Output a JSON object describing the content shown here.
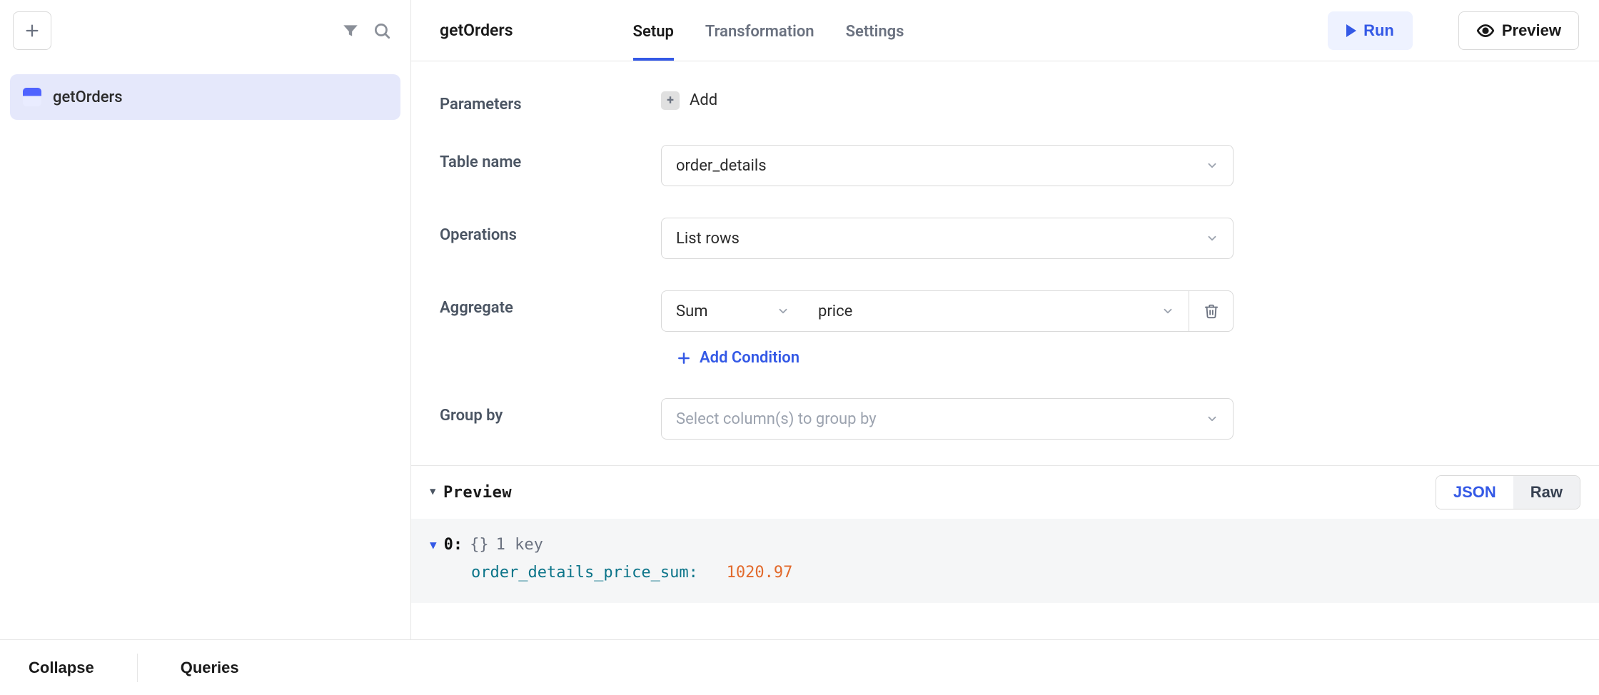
{
  "sidebar": {
    "items": [
      {
        "label": "getOrders"
      }
    ]
  },
  "header": {
    "title": "getOrders",
    "tabs": {
      "setup": "Setup",
      "transformation": "Transformation",
      "settings": "Settings"
    },
    "run": "Run",
    "preview": "Preview"
  },
  "form": {
    "parameters_label": "Parameters",
    "parameters_add": "Add",
    "table_label": "Table name",
    "table_value": "order_details",
    "operations_label": "Operations",
    "operations_value": "List rows",
    "aggregate_label": "Aggregate",
    "aggregate_func": "Sum",
    "aggregate_col": "price",
    "add_condition": "Add Condition",
    "groupby_label": "Group by",
    "groupby_placeholder": "Select column(s) to group by"
  },
  "preview": {
    "label": "Preview",
    "toggle_json": "JSON",
    "toggle_raw": "Raw",
    "row_idx": "0:",
    "row_meta_braces": "{}",
    "row_meta_keys": "1 key",
    "kv_key": "order_details_price_sum:",
    "kv_value": "1020.97"
  },
  "footer": {
    "collapse": "Collapse",
    "queries": "Queries"
  }
}
